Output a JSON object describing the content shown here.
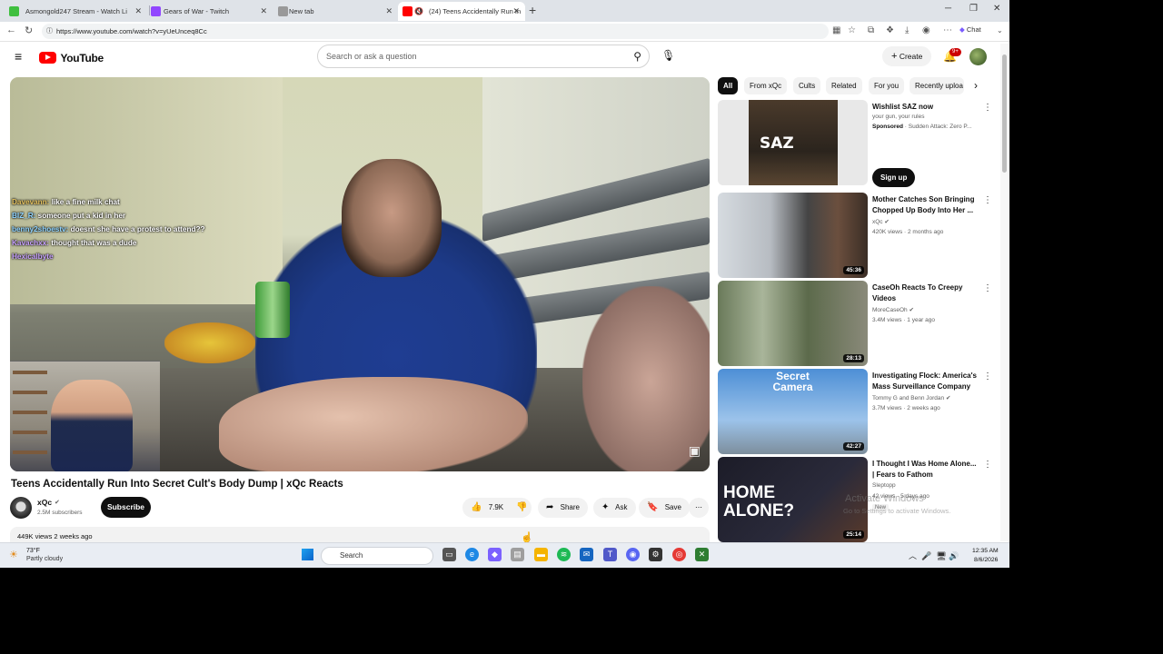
{
  "browser": {
    "tabs": [
      {
        "label": "Asmongold247 Stream - Watch Li",
        "favicon_color": "#3fbf3f"
      },
      {
        "label": "Gears of War - Twitch",
        "favicon_color": "#9146ff"
      },
      {
        "label": "New tab",
        "favicon_color": "#999999"
      },
      {
        "label": "(24) Teens Accidentally Run In",
        "favicon_color": "#ff0000"
      }
    ],
    "url": "https://www.youtube.com/watch?v=yUeUnceq8Cc",
    "chat_label": "Chat"
  },
  "youtube": {
    "logo_text": "YouTube",
    "search_placeholder": "Search or ask a question",
    "create_label": "Create",
    "notification_count": "9+"
  },
  "video": {
    "title": "Teens Accidentally Run Into Secret Cult's Body Dump | xQc Reacts",
    "channel": "xQc",
    "subscribers": "2.5M subscribers",
    "subscribe_label": "Subscribe",
    "likes": "7.9K",
    "share_label": "Share",
    "ask_label": "Ask",
    "save_label": "Save",
    "views_date": "449K views  2 weeks ago",
    "chat_overlay": [
      {
        "user": "Davevann:",
        "text": " like a fine milk chat"
      },
      {
        "user": "BIZ_R:",
        "text": " someone put a kid in her"
      },
      {
        "user": "benny2shoestv:",
        "text": " doesnt she have a protest to attend??"
      },
      {
        "user": "Kavachxx:",
        "text": " thought that was a dude"
      },
      {
        "user": "Hexicalbyte",
        "text": ""
      }
    ]
  },
  "filter_chips": [
    "All",
    "From xQc",
    "Cults",
    "Related",
    "For you",
    "Recently uploa"
  ],
  "ad": {
    "title": "Wishlist SAZ now",
    "subtitle": "your gun, your rules",
    "sponsored": "Sponsored",
    "advertiser": " · Sudden Attack: Zero P...",
    "cta": "Sign up"
  },
  "recommendations": [
    {
      "title": "Mother Catches Son Bringing Chopped Up Body Into Her ...",
      "channel": "xQc",
      "meta": "420K views · 2 months ago",
      "duration": "45:36"
    },
    {
      "title": "CaseOh Reacts To Creepy Videos",
      "channel": "MoreCaseOh",
      "meta": "3.4M views · 1 year ago",
      "duration": "28:13"
    },
    {
      "title": "Investigating Flock: America's Mass Surveillance Company",
      "channel": "Tommy G and Benn Jordan",
      "meta": "3.7M views · 2 weeks ago",
      "duration": "42:27"
    },
    {
      "title": "I Thought I Was Home Alone... | Fears to Fathom",
      "channel": "Sleptopp",
      "meta": "42 views · 5 days ago",
      "duration": "25:14",
      "badge": "New"
    }
  ],
  "thumb_texts": {
    "saz": "SAZ",
    "secret_camera": "Secret Camera",
    "home_alone": "HOME ALONE?"
  },
  "watermark": {
    "line1": "Activate Windows",
    "line2": "Go to Settings to activate Windows."
  },
  "taskbar": {
    "temperature": "73°F",
    "weather": "Partly cloudy",
    "search_label": "Search",
    "time": "12:35 AM",
    "date": "8/6/2026"
  }
}
